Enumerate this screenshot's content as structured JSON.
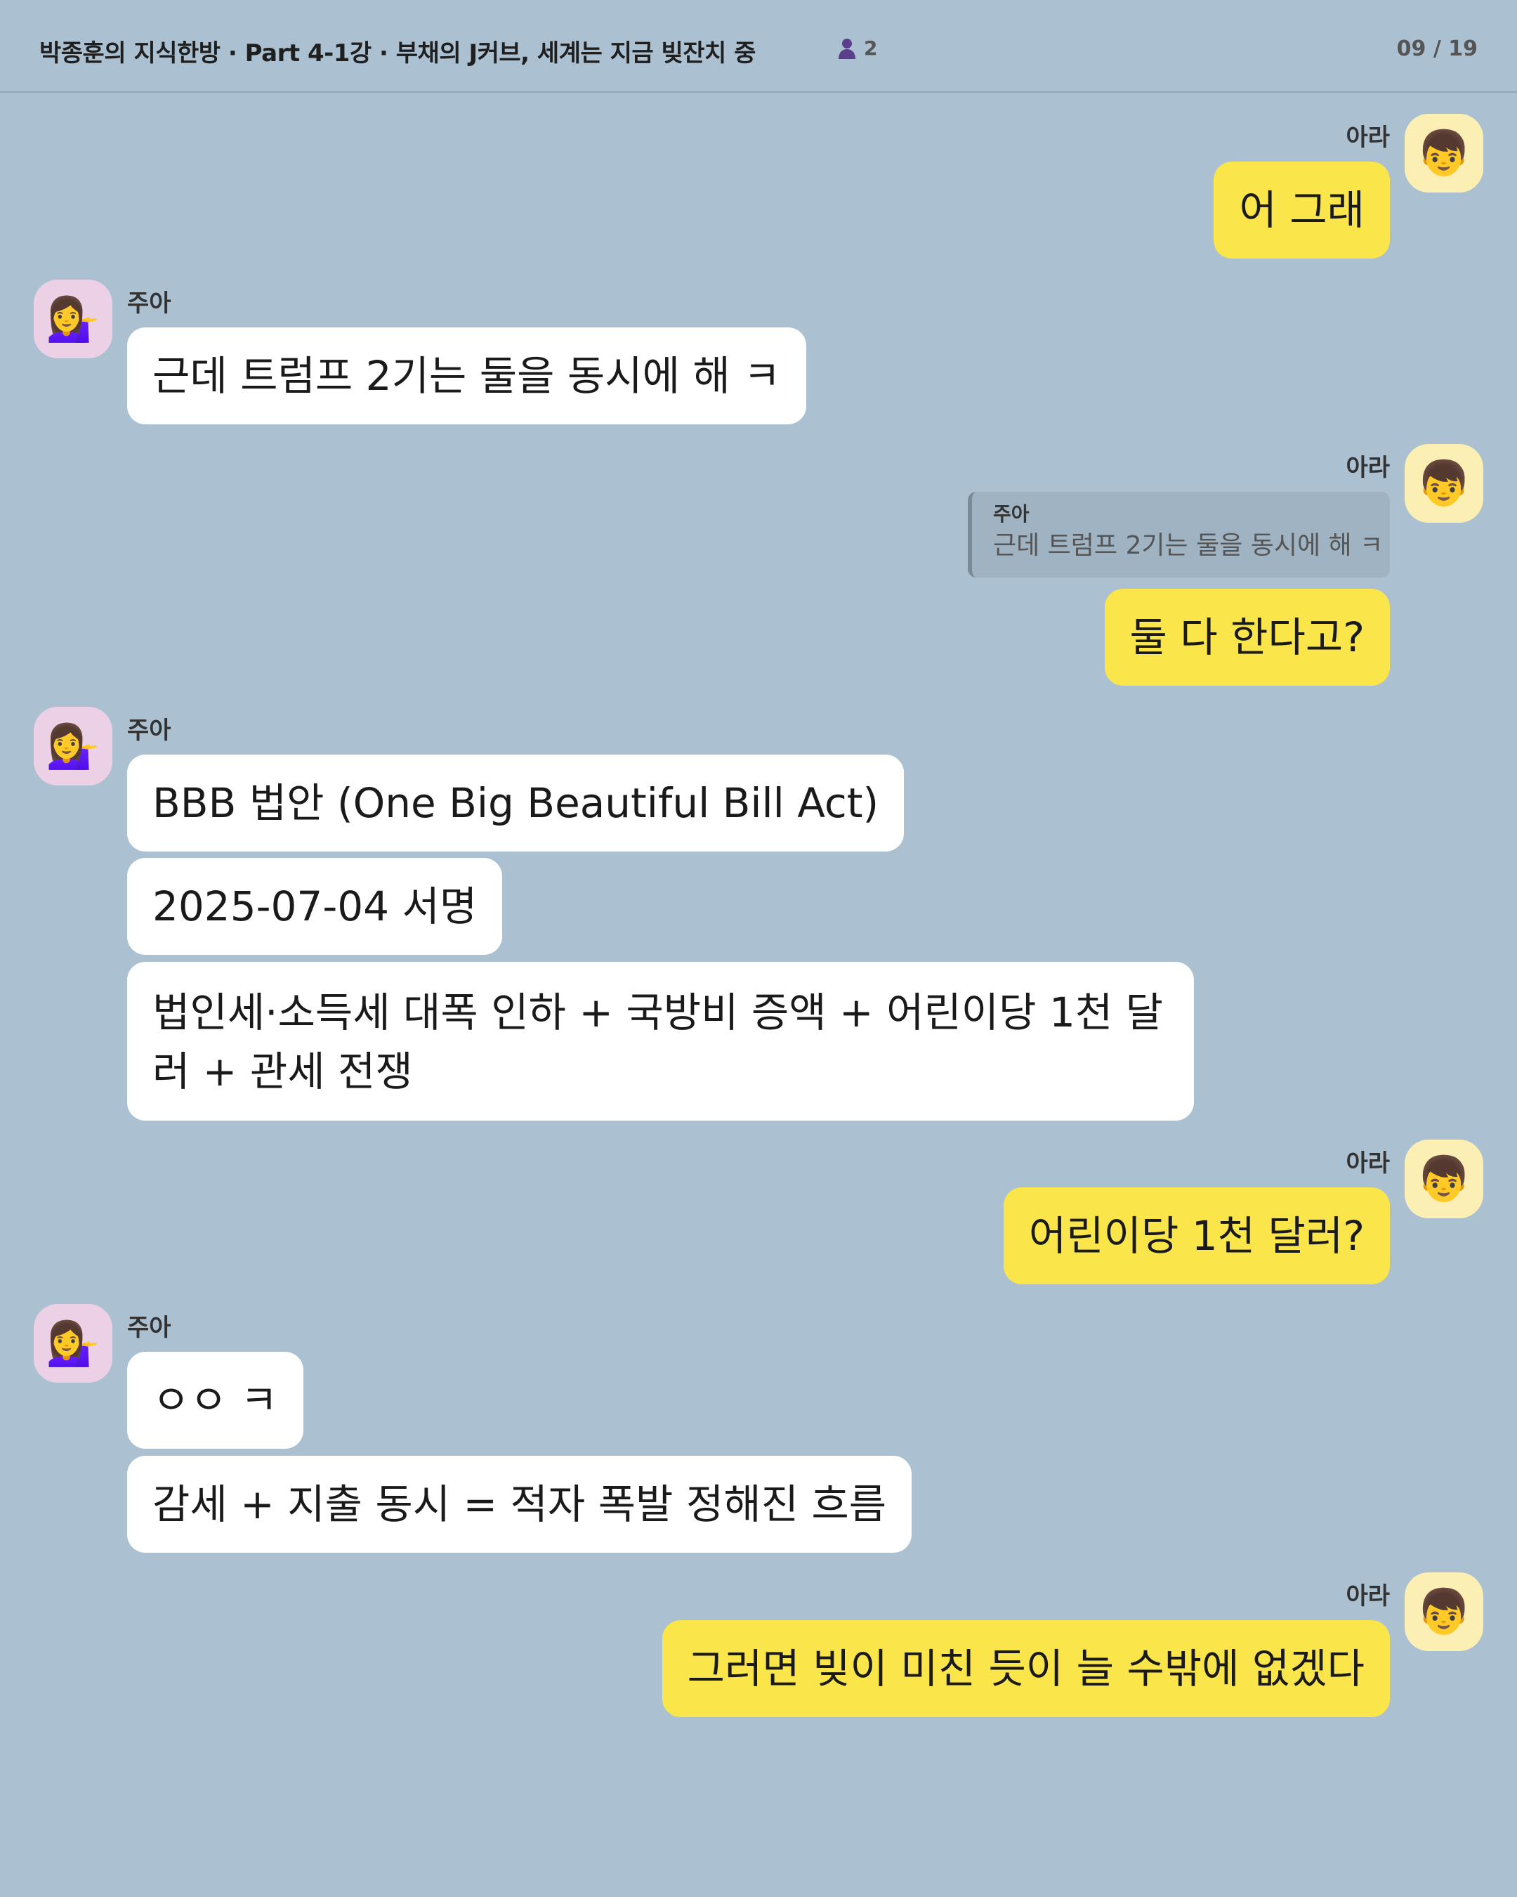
{
  "header": {
    "title": "박종훈의 지식한방 · Part 4-1강 · 부채의 J커브, 세계는 지금 빚잔치 중",
    "member_count": "2",
    "page_counter": "09 / 19"
  },
  "participants": {
    "me": {
      "name": "아라",
      "avatar_icon": "child-emoji-icon",
      "avatar_glyph": "👦"
    },
    "other": {
      "name": "주아",
      "avatar_icon": "woman-tipping-hand-emoji-icon",
      "avatar_glyph": "💁‍♀️"
    }
  },
  "colors": {
    "background": "#abc1d1",
    "my_bubble": "#fae54a",
    "other_bubble": "#ffffff"
  },
  "messages": [
    {
      "sender": "아라",
      "text": "어 그래"
    },
    {
      "sender": "주아",
      "text": "근데 트럼프 2기는 둘을 동시에 해 ㅋ"
    },
    {
      "sender": "아라",
      "reply_to": {
        "name": "주아",
        "text": "근데 트럼프 2기는 둘을 동시에 해 ㅋ"
      },
      "text": "둘 다 한다고?"
    },
    {
      "sender": "주아",
      "text": "BBB 법안 (One Big Beautiful Bill Act)"
    },
    {
      "sender": "주아",
      "text": "2025-07-04 서명"
    },
    {
      "sender": "주아",
      "text": "법인세·소득세 대폭 인하 + 국방비 증액 + 어린이당 1천 달러 + 관세 전쟁"
    },
    {
      "sender": "아라",
      "text": "어린이당 1천 달러?"
    },
    {
      "sender": "주아",
      "text": "ㅇㅇ ㅋ"
    },
    {
      "sender": "주아",
      "text": "감세 + 지출 동시 = 적자 폭발 정해진 흐름"
    },
    {
      "sender": "아라",
      "text": "그러면 빚이 미친 듯이 늘 수밖에 없겠다"
    }
  ]
}
